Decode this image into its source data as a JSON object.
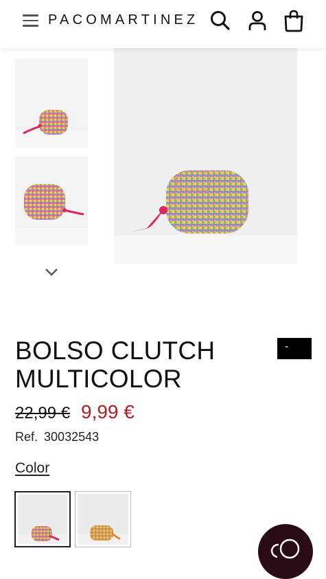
{
  "header": {
    "brand": "PACOMARTINEZ",
    "menu_icon": "hamburger-menu-icon",
    "search_icon": "search-icon",
    "account_icon": "user-icon",
    "cart_icon": "shopping-bag-icon"
  },
  "gallery": {
    "prev_icon": "chevron-up-icon",
    "next_icon": "chevron-down-icon"
  },
  "product": {
    "name": "BOLSO CLUTCH MULTICOLOR",
    "badge": "-",
    "price_original": "22,99 €",
    "price_sale": "9,99 €",
    "ref_label": "Ref.",
    "ref_value": "30032543",
    "color_label": "Color"
  },
  "colors": {
    "accent_sale": "#b01e23",
    "chat_button": "#2a0d14"
  },
  "chat": {
    "icon": "chat-bubbles-icon"
  }
}
